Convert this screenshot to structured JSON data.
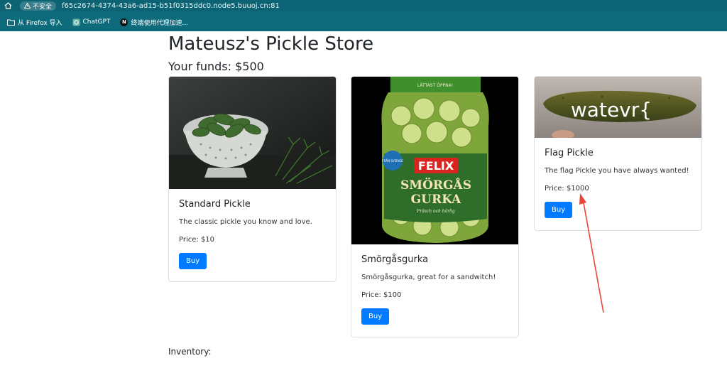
{
  "browser": {
    "security_label": "不安全",
    "url": "f65c2674-4374-43a6-ad15-b51f0315ddc0.node5.buuoj.cn:81",
    "bookmarks": [
      {
        "label": "从 Firefox 导入",
        "icon": "folder-icon"
      },
      {
        "label": "ChatGPT",
        "icon": "chatgpt-icon"
      },
      {
        "label": "终端使用代理加速...",
        "icon": "n-badge-icon",
        "badge": "N"
      }
    ]
  },
  "store": {
    "title": "Mateusz's Pickle Store",
    "funds": "Your funds: $500",
    "products": [
      {
        "name": "Standard Pickle",
        "description": "The classic pickle you know and love.",
        "price": "Price: $10",
        "buy_label": "Buy"
      },
      {
        "name": "Smörgåsgurka",
        "description": "Smörgåsgurka, great for a sandwitch!",
        "price": "Price: $100",
        "buy_label": "Buy",
        "jar_label": {
          "brand": "FELIX",
          "line1": "SMÖRGÅS",
          "line2": "GURKA",
          "script": "Fräsch och härlig",
          "badge": "FRÅN SVERIGE",
          "top": "LÄTTAST ÖPPNA!"
        }
      },
      {
        "name": "Flag Pickle",
        "description": "The flag Pickle you have always wanted!",
        "price": "Price: $1000",
        "buy_label": "Buy",
        "image_text": "watevr{"
      }
    ],
    "inventory_label": "Inventory:"
  },
  "colors": {
    "chrome": "#0e6b7c",
    "primary_button": "#007bff",
    "annotation_arrow": "#e8463a"
  }
}
